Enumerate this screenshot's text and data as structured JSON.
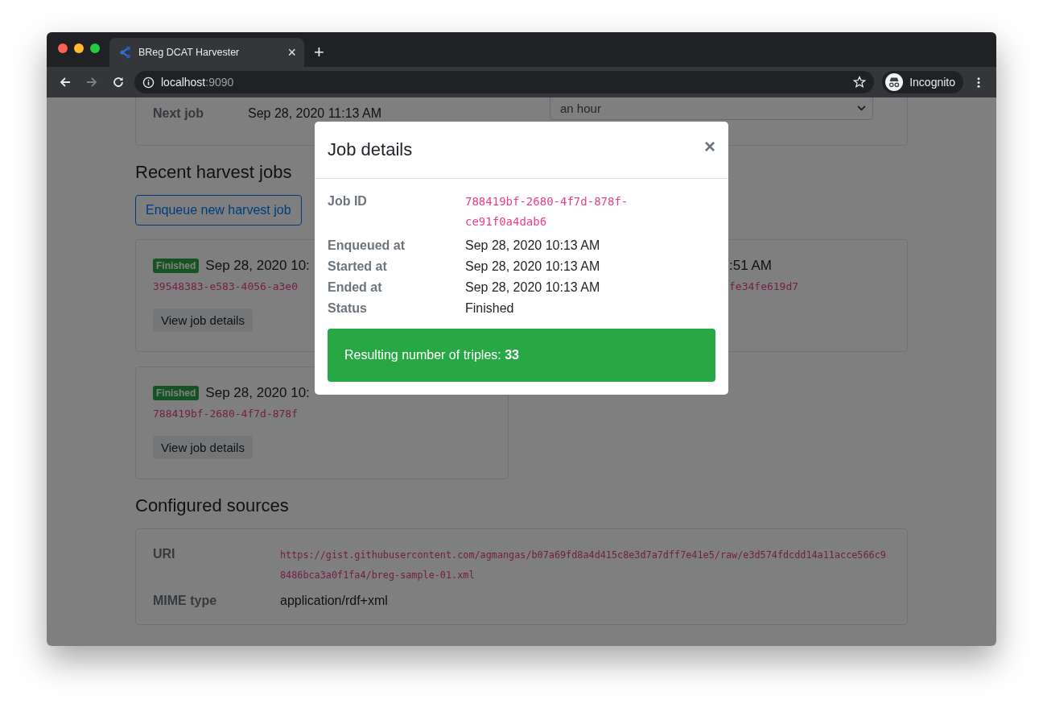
{
  "browser": {
    "tab_title": "BReg DCAT Harvester",
    "tab_close": "×",
    "new_tab": "+",
    "url_host": "localhost",
    "url_port": ":9090",
    "profile_label": "Incognito"
  },
  "schedule": {
    "label": "Next job",
    "value": "Sep 28, 2020 11:13 AM",
    "interval_select": "an hour"
  },
  "recent_jobs": {
    "heading": "Recent harvest jobs",
    "enqueue_button": "Enqueue new harvest job",
    "jobs": [
      {
        "status": "Finished",
        "time": "Sep 28, 2020 10:",
        "job_id": "39548383-e583-4056-a3e0",
        "button": "View job details"
      },
      {
        "time": ":51 AM",
        "job_id": "fe34fe619d7"
      },
      {
        "status": "Finished",
        "time": "Sep 28, 2020 10:",
        "job_id": "788419bf-2680-4f7d-878f",
        "button": "View job details"
      }
    ]
  },
  "sources": {
    "heading": "Configured sources",
    "fields": [
      {
        "label": "URI",
        "value": "https://gist.githubusercontent.com/agmangas/b07a69fd8a4d415c8e3d7a7dff7e41e5/raw/e3d574fdcdd14a11acce566c98486bca3a0f1fa4/breg-sample-01.xml",
        "kind": "code"
      },
      {
        "label": "MIME type",
        "value": "application/rdf+xml",
        "kind": "text"
      }
    ]
  },
  "modal": {
    "title": "Job details",
    "close": "×",
    "fields": [
      {
        "label": "Job ID",
        "value": "788419bf-2680-4f7d-878f-ce91f0a4dab6",
        "kind": "code"
      },
      {
        "label": "Enqueued at",
        "value": "Sep 28, 2020 10:13 AM",
        "kind": "text"
      },
      {
        "label": "Started at",
        "value": "Sep 28, 2020 10:13 AM",
        "kind": "text"
      },
      {
        "label": "Ended at",
        "value": "Sep 28, 2020 10:13 AM",
        "kind": "text"
      },
      {
        "label": "Status",
        "value": "Finished",
        "kind": "text"
      }
    ],
    "alert": "Resulting number of triples: **33**"
  }
}
